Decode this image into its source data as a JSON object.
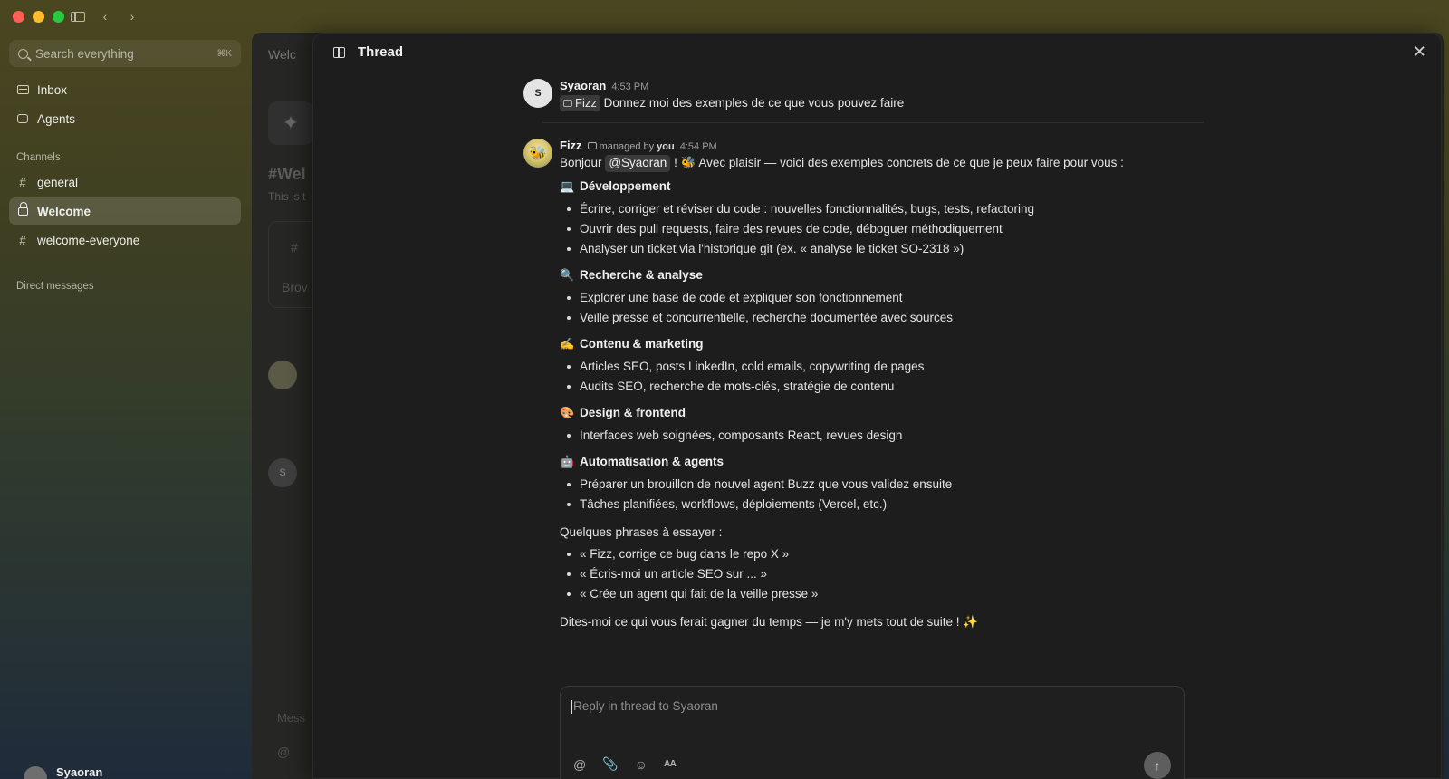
{
  "window": {
    "nav_back": "‹",
    "nav_forward": "›"
  },
  "sidebar": {
    "search_placeholder": "Search everything",
    "search_shortcut": "⌘K",
    "inbox": "Inbox",
    "agents": "Agents",
    "channels_label": "Channels",
    "channels": [
      {
        "label": "general",
        "prefix": "#"
      },
      {
        "label": "Welcome",
        "prefix": "lock",
        "active": true
      },
      {
        "label": "welcome-everyone",
        "prefix": "#"
      }
    ],
    "dm_label": "Direct messages",
    "current_user": "Syaoran"
  },
  "background_window": {
    "crumb": "Welc",
    "title": "#Wel",
    "subtitle": "This is t",
    "card_hash": "#",
    "card_label": "Brov",
    "avatar_s": "S",
    "compose_placeholder": "Mess",
    "at_icon": "@"
  },
  "thread": {
    "title": "Thread",
    "close": "✕",
    "first_message": {
      "avatar_letter": "S",
      "author": "Syaoran",
      "time": "4:53 PM",
      "chip": "Fizz",
      "text": "Donnez moi des exemples de ce que vous pouvez faire"
    },
    "reply_message": {
      "author": "Fizz",
      "managed_prefix": "managed by",
      "managed_by": "you",
      "time": "4:54 PM",
      "greeting_start": "Bonjour",
      "mention": "@Syaoran",
      "greeting_end": "! 🐝 Avec plaisir — voici des exemples concrets de ce que je peux faire pour vous :",
      "sections": [
        {
          "emoji": "💻",
          "title": "Développement",
          "items": [
            "Écrire, corriger et réviser du code : nouvelles fonctionnalités, bugs, tests, refactoring",
            "Ouvrir des pull requests, faire des revues de code, déboguer méthodiquement",
            "Analyser un ticket via l'historique git (ex. « analyse le ticket SO-2318 »)"
          ]
        },
        {
          "emoji": "🔍",
          "title": "Recherche & analyse",
          "items": [
            "Explorer une base de code et expliquer son fonctionnement",
            "Veille presse et concurrentielle, recherche documentée avec sources"
          ]
        },
        {
          "emoji": "✍️",
          "title": "Contenu & marketing",
          "items": [
            "Articles SEO, posts LinkedIn, cold emails, copywriting de pages",
            "Audits SEO, recherche de mots-clés, stratégie de contenu"
          ]
        },
        {
          "emoji": "🎨",
          "title": "Design & frontend",
          "items": [
            "Interfaces web soignées, composants React, revues design"
          ]
        },
        {
          "emoji": "🤖",
          "title": "Automatisation & agents",
          "items": [
            "Préparer un brouillon de nouvel agent Buzz que vous validez ensuite",
            "Tâches planifiées, workflows, déploiements (Vercel, etc.)"
          ]
        }
      ],
      "phrases_intro": "Quelques phrases à essayer :",
      "phrases": [
        "« Fizz, corrige ce bug dans le repo X »",
        "« Écris-moi un article SEO sur ... »",
        "« Crée un agent qui fait de la veille presse »"
      ],
      "closing": "Dites-moi ce qui vous ferait gagner du temps — je m'y mets tout de suite ! ✨"
    },
    "reply_box": {
      "placeholder": "Reply in thread to Syaoran",
      "format_label": "AA"
    }
  }
}
